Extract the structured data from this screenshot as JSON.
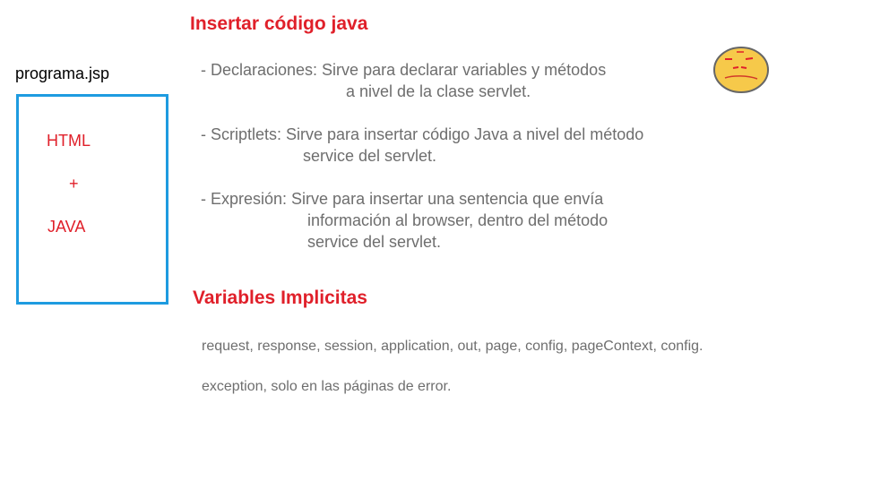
{
  "file_label": "programa.jsp",
  "box": {
    "line1": "HTML",
    "line2": "+",
    "line3": "JAVA"
  },
  "section1": {
    "title": "Insertar código java",
    "declaraciones": {
      "line1": "- Declaraciones: Sirve para declarar variables y métodos",
      "line2": "a nivel de la clase servlet."
    },
    "scriptlets": {
      "line1": "- Scriptlets: Sirve para insertar código Java a nivel del método",
      "line2": "service del servlet."
    },
    "expresion": {
      "line1": "- Expresión: Sirve para insertar una sentencia que envía",
      "line2": "información al browser, dentro del método",
      "line3": "service del servlet."
    }
  },
  "section2": {
    "title": "Variables Implicitas",
    "line1": "request, response, session, application, out, page, config, pageContext, config.",
    "line2": "exception, solo en las páginas de error."
  },
  "icons": {
    "face": "confused-face-icon"
  },
  "colors": {
    "accent_red": "#e0202a",
    "box_blue": "#1e9be0",
    "text_gray": "#6e6e6e",
    "face_fill": "#f6c94a"
  }
}
